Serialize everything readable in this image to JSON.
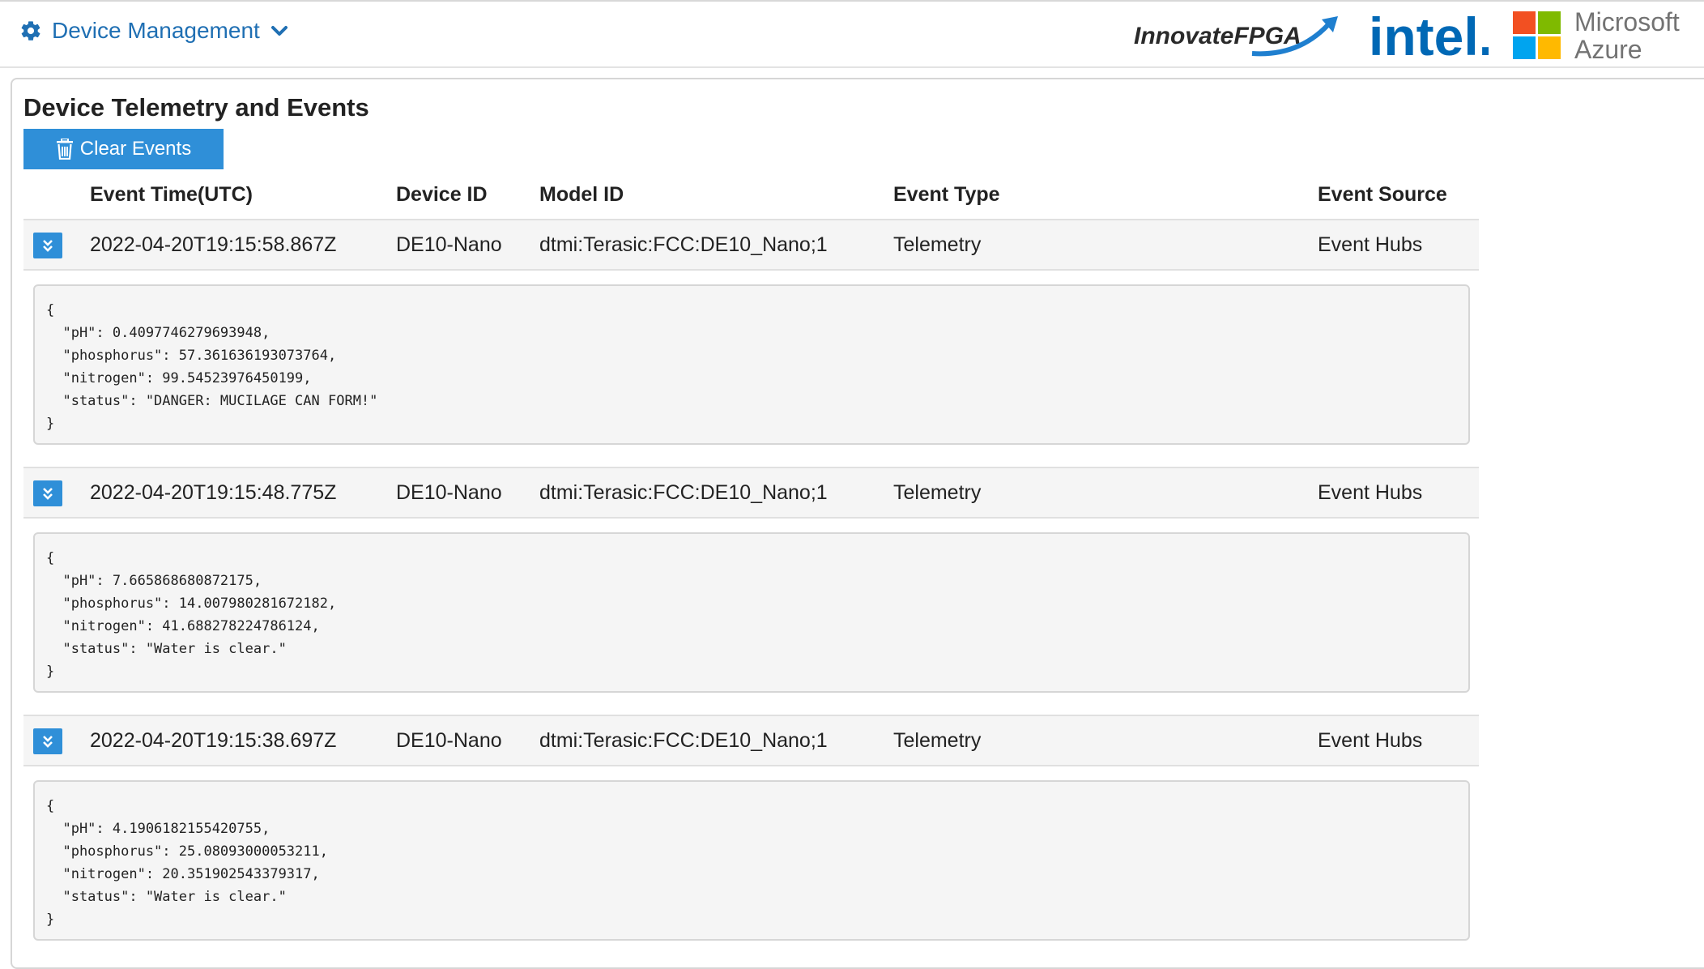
{
  "nav": {
    "menu_label": "Device Management"
  },
  "logos": {
    "fpga_text_a": "Innovate",
    "fpga_text_b": "FPGA",
    "intel_text": "intel.",
    "microsoft_line1": "Microsoft",
    "microsoft_line2": "Azure",
    "microsoft_colors": [
      "#f25022",
      "#7fba00",
      "#00a4ef",
      "#ffb900"
    ]
  },
  "colors": {
    "accent": "#2f8fd8",
    "link": "#1f6fb3"
  },
  "section": {
    "title": "Device Telemetry and Events",
    "clear_button": "Clear Events"
  },
  "table": {
    "headers": [
      "Event Time(UTC)",
      "Device ID",
      "Model ID",
      "Event Type",
      "Event Source"
    ],
    "rows": [
      {
        "time": "2022-04-20T19:15:58.867Z",
        "device": "DE10-Nano",
        "model": "dtmi:Terasic:FCC:DE10_Nano;1",
        "type": "Telemetry",
        "source": "Event Hubs",
        "payload": "{\n  \"pH\": 0.4097746279693948,\n  \"phosphorus\": 57.361636193073764,\n  \"nitrogen\": 99.54523976450199,\n  \"status\": \"DANGER: MUCILAGE CAN FORM!\"\n}"
      },
      {
        "time": "2022-04-20T19:15:48.775Z",
        "device": "DE10-Nano",
        "model": "dtmi:Terasic:FCC:DE10_Nano;1",
        "type": "Telemetry",
        "source": "Event Hubs",
        "payload": "{\n  \"pH\": 7.665868680872175,\n  \"phosphorus\": 14.007980281672182,\n  \"nitrogen\": 41.688278224786124,\n  \"status\": \"Water is clear.\"\n}"
      },
      {
        "time": "2022-04-20T19:15:38.697Z",
        "device": "DE10-Nano",
        "model": "dtmi:Terasic:FCC:DE10_Nano;1",
        "type": "Telemetry",
        "source": "Event Hubs",
        "payload": "{\n  \"pH\": 4.1906182155420755,\n  \"phosphorus\": 25.08093000053211,\n  \"nitrogen\": 20.351902543379317,\n  \"status\": \"Water is clear.\"\n}"
      }
    ]
  }
}
